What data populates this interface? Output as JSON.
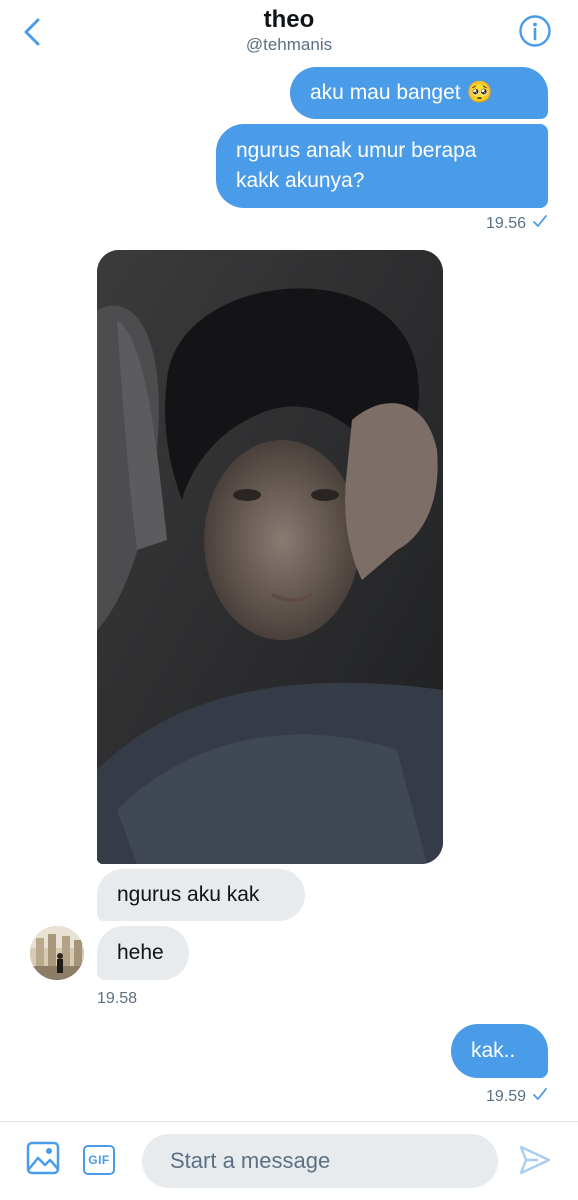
{
  "header": {
    "title": "theo",
    "handle": "@tehmanis"
  },
  "messages": [
    {
      "direction": "out",
      "text": "aku mau banget 🥺"
    },
    {
      "direction": "out",
      "text": "ngurus anak umur berapa\nkakk akunya?"
    },
    {
      "direction": "in",
      "type": "photo",
      "text": ""
    },
    {
      "direction": "in",
      "text": "ngurus aku kak"
    },
    {
      "direction": "in",
      "text": "hehe"
    },
    {
      "direction": "out",
      "text": "kak.."
    }
  ],
  "timestamps": {
    "t1": "19.56",
    "t2": "19.58",
    "t3": "19.59"
  },
  "composer": {
    "placeholder": "Start a message",
    "gif_label": "GIF"
  },
  "colors": {
    "accent": "#4a9be8",
    "incoming_bubble": "#e8ebed",
    "secondary_text": "#5b7083"
  },
  "icons": {
    "back": "chevron-left-icon",
    "info": "info-icon",
    "read": "checkmark-icon",
    "media": "image-icon",
    "send": "send-icon"
  }
}
